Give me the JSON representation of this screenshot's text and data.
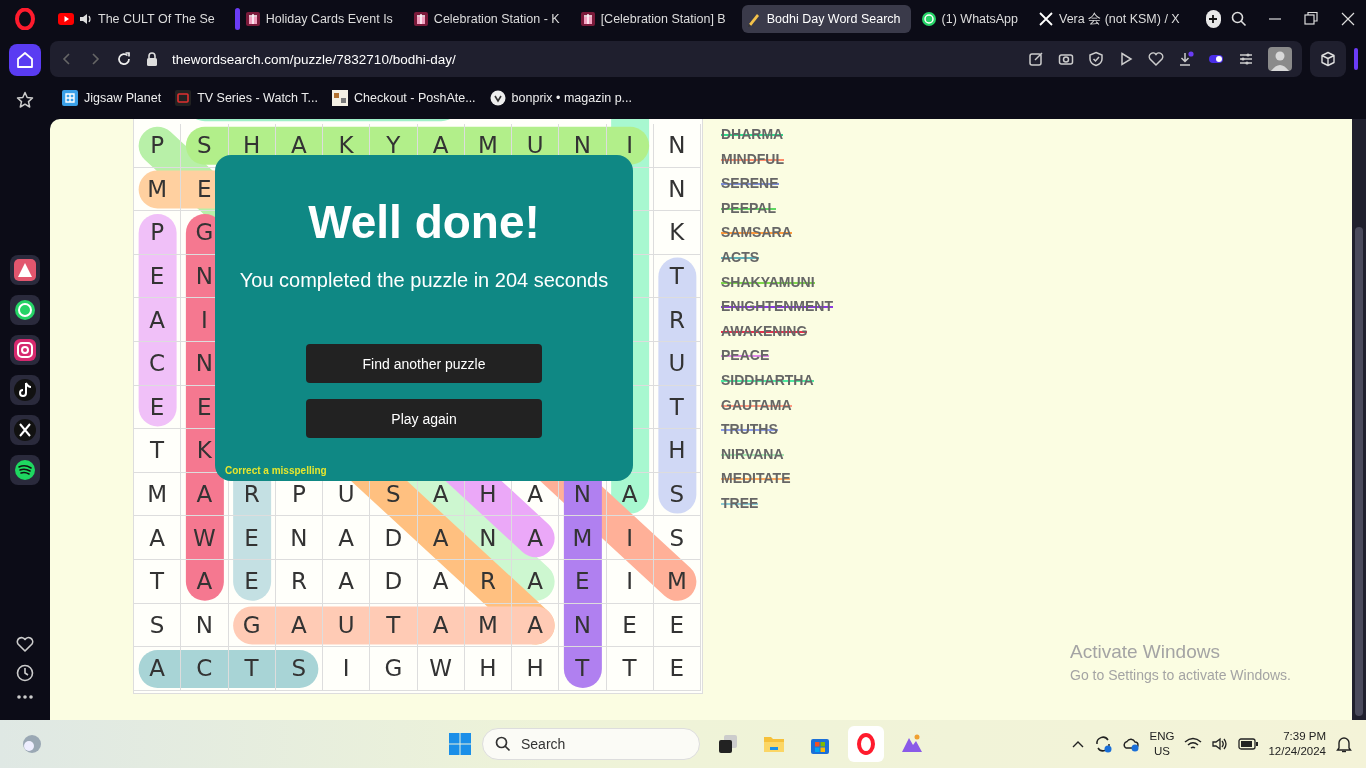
{
  "browser": {
    "tabs": [
      {
        "title": "The CULT Of The Se",
        "kind": "video",
        "audio": true,
        "group_marker": false,
        "selected": false
      },
      {
        "title": "Holiday Cards Event Is",
        "kind": "gift",
        "audio": false,
        "group_marker": true,
        "selected": false
      },
      {
        "title": "Celebration Station - K",
        "kind": "gift",
        "audio": false,
        "group_marker": false,
        "selected": false
      },
      {
        "title": "[Celebration Station] B",
        "kind": "gift",
        "audio": false,
        "group_marker": false,
        "selected": false
      },
      {
        "title": "Bodhi Day Word Search",
        "kind": "pencil",
        "audio": false,
        "group_marker": false,
        "selected": true
      },
      {
        "title": "(1) WhatsApp",
        "kind": "chat",
        "audio": false,
        "group_marker": false,
        "selected": false
      },
      {
        "title": "Vera 会 (not KSM) / X",
        "kind": "x",
        "audio": false,
        "group_marker": false,
        "selected": false
      }
    ],
    "address": {
      "domain": "thewordsearch.com",
      "path": "/puzzle/7832710/bodhi-day/"
    },
    "bookmarks": [
      {
        "title": "Jigsaw Planet",
        "kind": "puzzle"
      },
      {
        "title": "TV Series - Watch T...",
        "kind": "tv"
      },
      {
        "title": "Checkout - PoshAte...",
        "kind": "shop"
      },
      {
        "title": "bonprix • magazin p...",
        "kind": "store"
      }
    ]
  },
  "puzzle": {
    "rows": [
      {
        "letters": [
          "P",
          "S",
          "H",
          "A",
          "K",
          "Y",
          "A",
          "M",
          "U",
          "N",
          "I",
          "N"
        ]
      },
      {
        "left": [
          "M",
          "E"
        ],
        "right": [
          "N"
        ]
      },
      {
        "left": [
          "P",
          "G"
        ],
        "right": [
          "K"
        ]
      },
      {
        "left": [
          "E",
          "N"
        ],
        "right": [
          "T"
        ]
      },
      {
        "left": [
          "A",
          "I"
        ],
        "right": [
          "R"
        ]
      },
      {
        "left": [
          "C",
          "N"
        ],
        "right": [
          "U"
        ]
      },
      {
        "left": [
          "E",
          "E"
        ],
        "right": [
          "T"
        ]
      },
      {
        "left": [
          "T",
          "K"
        ],
        "right": [
          "H"
        ]
      },
      {
        "letters": [
          "M",
          "A",
          "R",
          "P",
          "U",
          "S",
          "A",
          "H",
          "A",
          "N",
          "A",
          "S"
        ]
      },
      {
        "letters": [
          "A",
          "W",
          "E",
          "N",
          "A",
          "D",
          "A",
          "N",
          "A",
          "M",
          "I",
          "S"
        ]
      },
      {
        "letters": [
          "T",
          "A",
          "E",
          "R",
          "A",
          "D",
          "A",
          "R",
          "A",
          "E",
          "I",
          "M"
        ]
      },
      {
        "letters": [
          "S",
          "N",
          "G",
          "A",
          "U",
          "T",
          "A",
          "M",
          "A",
          "N",
          "E",
          "E"
        ]
      },
      {
        "letters": [
          "A",
          "C",
          "T",
          "S",
          "I",
          "G",
          "W",
          "H",
          "H",
          "T",
          "T",
          "E"
        ]
      }
    ],
    "highlights": [
      {
        "color": "#9ff0c8"
      },
      {
        "color": "#a8f8d0"
      },
      {
        "color": "#b8f0a8"
      },
      {
        "color": "#b2ef8a"
      },
      {
        "color": "#ffd0a0"
      },
      {
        "color": "#f0c0f8"
      },
      {
        "color": "#f57890"
      },
      {
        "color": "#d0d8f5"
      },
      {
        "color": "#c4e0e3"
      },
      {
        "color": "#cdf7d0"
      },
      {
        "color": "#eba8f8"
      },
      {
        "color": "#ffc080"
      },
      {
        "color": "#ffb098"
      },
      {
        "color": "#ffcbb5"
      },
      {
        "color": "#b080f0"
      },
      {
        "color": "#a8d4d6"
      }
    ]
  },
  "words": [
    {
      "text": "DHARMA",
      "found": true,
      "color": "#2ed88a"
    },
    {
      "text": "MINDFUL",
      "found": true,
      "color": "#ff8c6a"
    },
    {
      "text": "SERENE",
      "found": true,
      "color": "#7d8fd8"
    },
    {
      "text": "PEEPAL",
      "found": true,
      "color": "#5ed860"
    },
    {
      "text": "SAMSARA",
      "found": true,
      "color": "#ff9a3a"
    },
    {
      "text": "ACTS",
      "found": true,
      "color": "#5fb0b8"
    },
    {
      "text": "SHAKYAMUNI",
      "found": true,
      "color": "#7ed84a"
    },
    {
      "text": "ENIGHTENMENT",
      "found": true,
      "color": "#8a3ae0"
    },
    {
      "text": "AWAKENING",
      "found": true,
      "color": "#e8304e"
    },
    {
      "text": "PEACE",
      "found": true,
      "color": "#e08ae8"
    },
    {
      "text": "SIDDHARTHA",
      "found": true,
      "color": "#4ee8a0"
    },
    {
      "text": "GAUTAMA",
      "found": true,
      "color": "#ff9a80"
    },
    {
      "text": "TRUTHS",
      "found": true,
      "color": "#8a9ae8"
    },
    {
      "text": "NIRVANA",
      "found": true,
      "color": "#a8e8b0"
    },
    {
      "text": "MEDITATE",
      "found": true,
      "color": "#ffaa60"
    },
    {
      "text": "TREE",
      "found": true,
      "color": "#8accd4"
    }
  ],
  "dialog": {
    "title": "Well done!",
    "message": "You completed the puzzle in 204 seconds",
    "buttons": [
      "Find another puzzle",
      "Play again"
    ],
    "link": "Correct a misspelling"
  },
  "watermark": {
    "title": "Activate Windows",
    "subtitle": "Go to Settings to activate Windows."
  },
  "taskbar": {
    "search_placeholder": "Search",
    "language": "ENG",
    "region": "US",
    "time": "7:39 PM",
    "date": "12/24/2024"
  }
}
